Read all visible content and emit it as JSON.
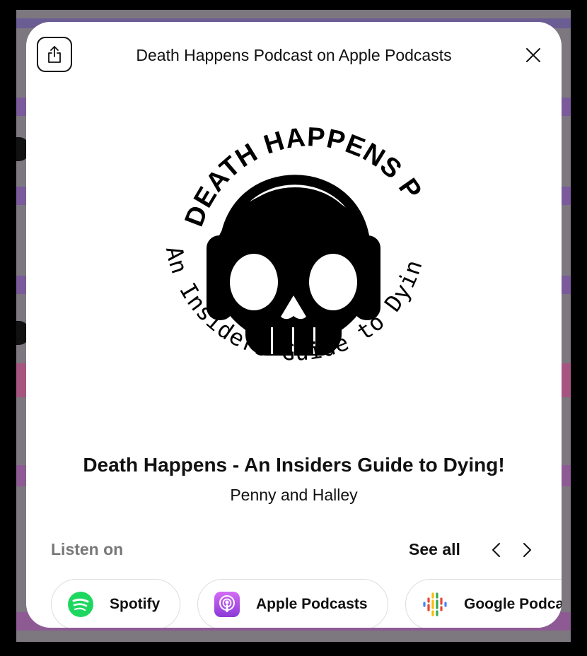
{
  "modal": {
    "title": "Death Happens Podcast on Apple Podcasts",
    "share_icon": "share-icon",
    "close_icon": "close-icon"
  },
  "podcast": {
    "title": "Death Happens - An Insiders Guide to Dying!",
    "author": "Penny and Halley",
    "cover_top_text": "DEATH HAPPENS PODCAST",
    "cover_bottom_text": "An Insiders Guide to Dying"
  },
  "listen": {
    "label": "Listen on",
    "see_all": "See all",
    "prev_icon": "chevron-left-icon",
    "next_icon": "chevron-right-icon",
    "platforms": [
      {
        "name": "Spotify",
        "icon": "spotify-icon",
        "color": "#1ed760"
      },
      {
        "name": "Apple Podcasts",
        "icon": "apple-podcasts-icon",
        "color": "#9b4fe0"
      },
      {
        "name": "Google Podcasts",
        "icon": "google-podcasts-icon",
        "color": "#4285f4"
      }
    ]
  },
  "colors": {
    "background_overlay": "#7d7780",
    "band_purple": "#5a4a82",
    "band_pink": "#b04a78",
    "text_primary": "#111111",
    "text_muted": "#777777"
  }
}
